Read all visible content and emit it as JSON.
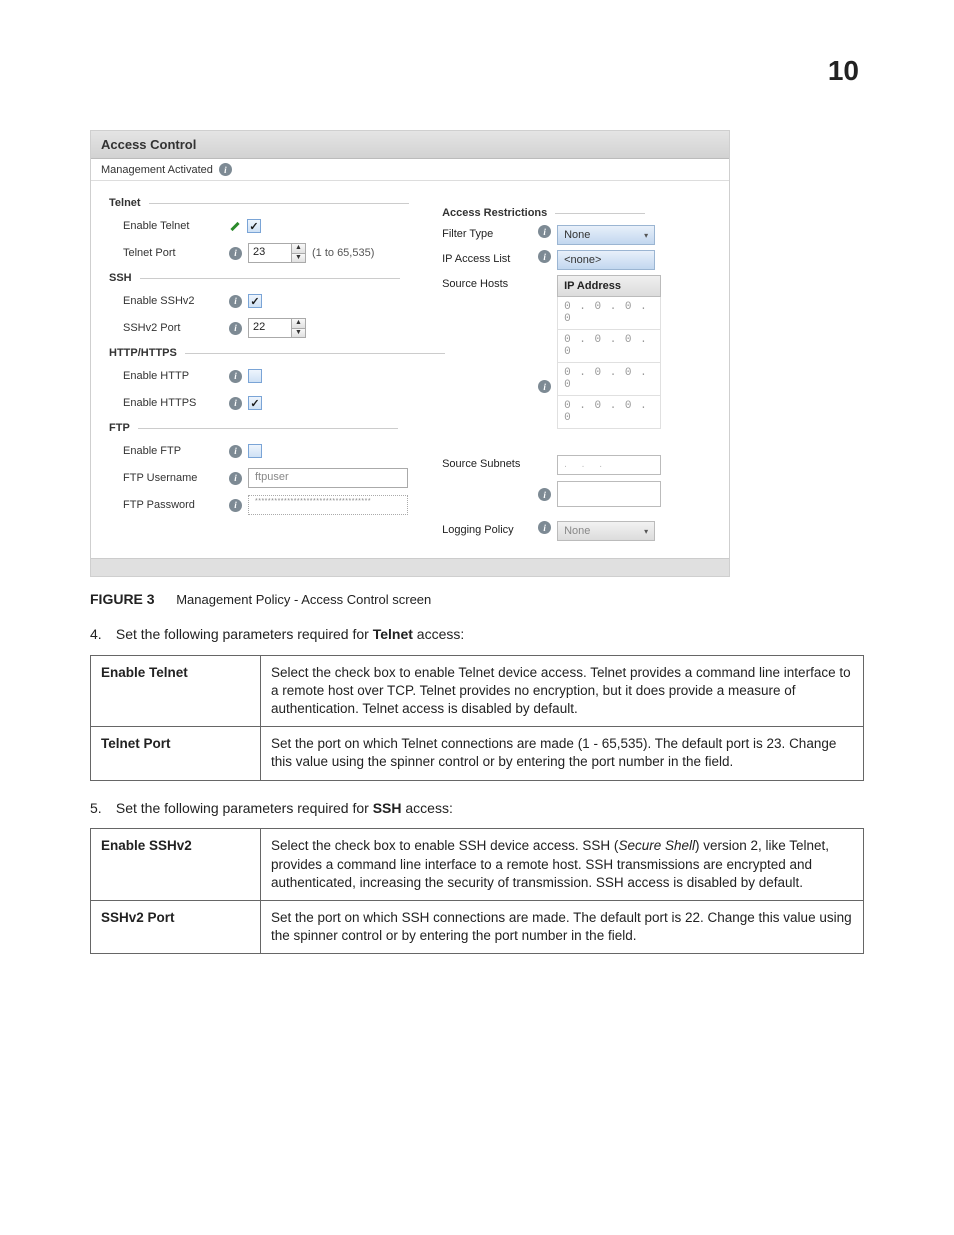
{
  "page_number": "10",
  "panel": {
    "title": "Access Control",
    "subtitle": "Management Activated",
    "telnet": {
      "group": "Telnet",
      "enable_label": "Enable Telnet",
      "enable_checked": true,
      "port_label": "Telnet Port",
      "port_value": "23",
      "port_hint": "(1 to 65,535)"
    },
    "ssh": {
      "group": "SSH",
      "enable_label": "Enable SSHv2",
      "enable_checked": true,
      "port_label": "SSHv2 Port",
      "port_value": "22"
    },
    "http": {
      "group": "HTTP/HTTPS",
      "http_label": "Enable HTTP",
      "http_checked": false,
      "https_label": "Enable HTTPS",
      "https_checked": true
    },
    "ftp": {
      "group": "FTP",
      "enable_label": "Enable FTP",
      "enable_checked": false,
      "user_label": "FTP Username",
      "user_value": "ftpuser",
      "pass_label": "FTP Password",
      "pass_value": "************************************"
    },
    "restrictions": {
      "group": "Access Restrictions",
      "filter_label": "Filter Type",
      "filter_value": "None",
      "acl_label": "IP Access List",
      "acl_value": "<none>",
      "hosts_label": "Source Hosts",
      "ip_header": "IP Address",
      "ip_rows": [
        "0 . 0 . 0 . 0",
        "0 . 0 . 0 . 0",
        "0 . 0 . 0 . 0",
        "0 . 0 . 0 . 0"
      ],
      "subnets_label": "Source Subnets",
      "subnet_dots": ". . .",
      "logging_label": "Logging Policy",
      "logging_value": "None"
    }
  },
  "figure": {
    "num": "FIGURE 3",
    "caption": "Management Policy - Access Control screen"
  },
  "step4": {
    "num": "4.",
    "text_before": "Set the following parameters required for ",
    "text_bold": "Telnet",
    "text_after": " access:"
  },
  "table1": {
    "r1_label": "Enable Telnet",
    "r1_desc": "Select the check box to enable Telnet device access. Telnet provides a command line interface to a remote host over TCP. Telnet provides no encryption, but it does provide a measure of authentication. Telnet access is disabled by default.",
    "r2_label": "Telnet Port",
    "r2_desc": "Set the port on which Telnet connections are made (1 - 65,535). The default port is 23. Change this value using the spinner control or by entering the port number in the field."
  },
  "step5": {
    "num": "5.",
    "text_before": "Set the following parameters required for ",
    "text_bold": "SSH",
    "text_after": " access:"
  },
  "table2": {
    "r1_label": "Enable SSHv2",
    "r1_before": "Select the check box to enable SSH device access. SSH (",
    "r1_italic": "Secure Shell",
    "r1_after": ") version 2, like Telnet, provides a command line interface to a remote host. SSH transmissions are encrypted and authenticated, increasing the security of transmission. SSH access is disabled by default.",
    "r2_label": "SSHv2 Port",
    "r2_desc": "Set the port on which SSH connections are made. The default port is 22. Change this value using the spinner control or by entering the port number in the field."
  }
}
